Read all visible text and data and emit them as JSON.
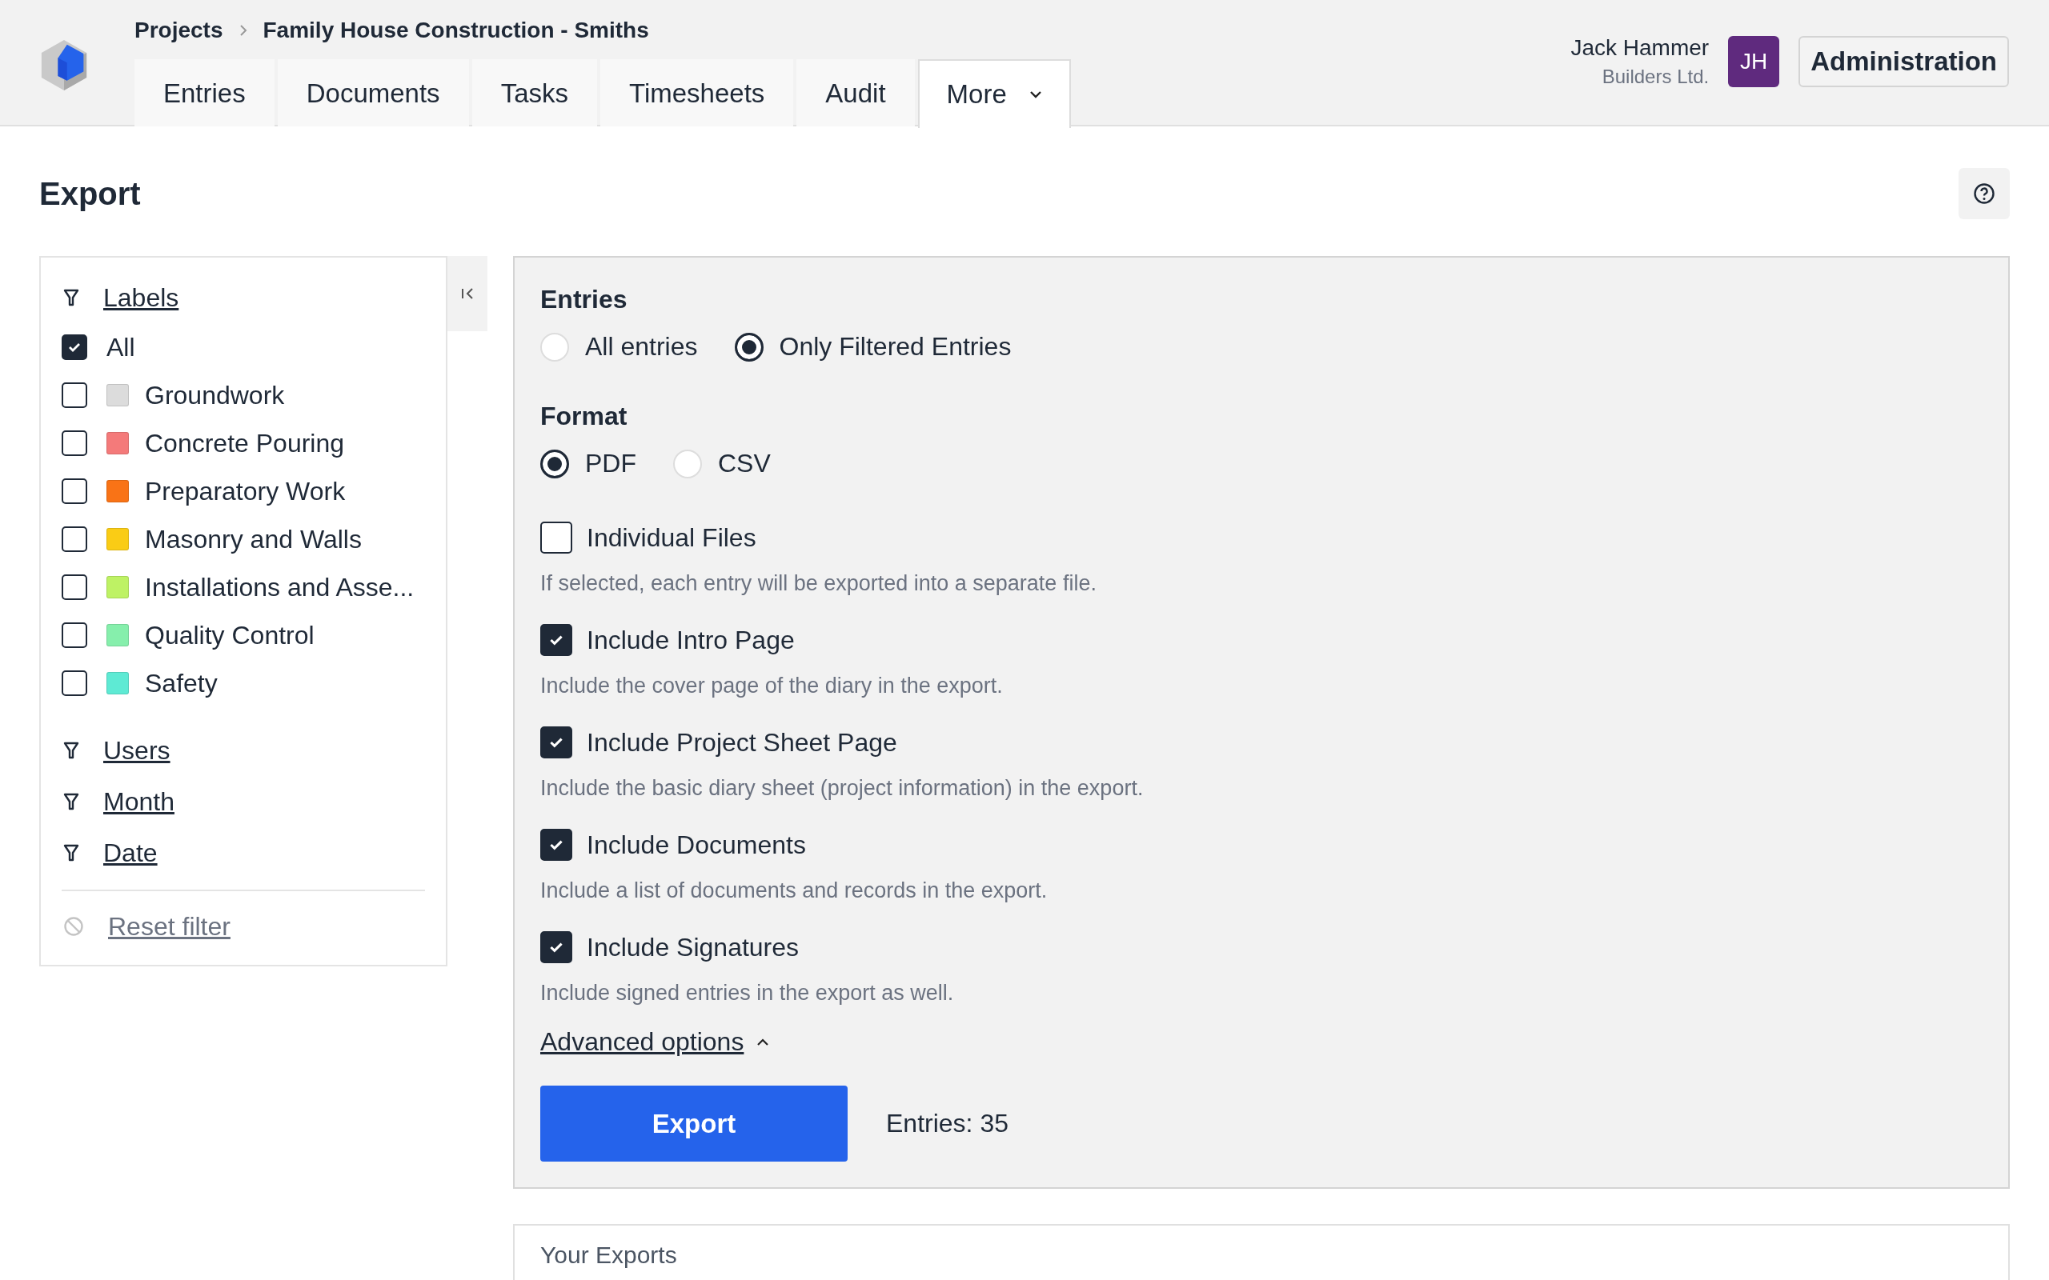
{
  "breadcrumb": [
    {
      "label": "Projects"
    },
    {
      "label": "Family House Construction - Smiths"
    }
  ],
  "tabs": [
    {
      "label": "Entries",
      "selected": false,
      "dropdown": false
    },
    {
      "label": "Documents",
      "selected": false,
      "dropdown": false
    },
    {
      "label": "Tasks",
      "selected": false,
      "dropdown": false
    },
    {
      "label": "Timesheets",
      "selected": false,
      "dropdown": false
    },
    {
      "label": "Audit",
      "selected": false,
      "dropdown": false
    },
    {
      "label": "More",
      "selected": true,
      "dropdown": true
    }
  ],
  "user": {
    "name": "Jack Hammer",
    "company": "Builders Ltd.",
    "initials": "JH"
  },
  "admin_button": "Administration",
  "page_title": "Export",
  "filters": {
    "labels_heading": "Labels",
    "labels": [
      {
        "label": "All",
        "checked": true
      },
      {
        "label": "Groundwork",
        "checked": false,
        "color": "#dcdcdc"
      },
      {
        "label": "Concrete Pouring",
        "checked": false,
        "color": "#f47a7a"
      },
      {
        "label": "Preparatory Work",
        "checked": false,
        "color": "#f97316"
      },
      {
        "label": "Masonry and Walls",
        "checked": false,
        "color": "#facc15"
      },
      {
        "label": "Installations and Asse...",
        "checked": false,
        "color": "#bef264"
      },
      {
        "label": "Quality Control",
        "checked": false,
        "color": "#86efac"
      },
      {
        "label": "Safety",
        "checked": false,
        "color": "#5eead4"
      }
    ],
    "other_filters": [
      "Users",
      "Month",
      "Date"
    ],
    "reset": "Reset filter"
  },
  "entries_group": {
    "title": "Entries",
    "options": [
      {
        "label": "All entries",
        "selected": false
      },
      {
        "label": "Only Filtered Entries",
        "selected": true
      }
    ]
  },
  "format_group": {
    "title": "Format",
    "options": [
      {
        "label": "PDF",
        "selected": true
      },
      {
        "label": "CSV",
        "selected": false
      }
    ]
  },
  "options": [
    {
      "label": "Individual Files",
      "checked": false,
      "description": "If selected, each entry will be exported into a separate file."
    },
    {
      "label": "Include Intro Page",
      "checked": true,
      "description": "Include the cover page of the diary in the export."
    },
    {
      "label": "Include Project Sheet Page",
      "checked": true,
      "description": "Include the basic diary sheet (project information) in the export."
    },
    {
      "label": "Include Documents",
      "checked": true,
      "description": "Include a list of documents and records in the export."
    },
    {
      "label": "Include Signatures",
      "checked": true,
      "description": "Include signed entries in the export as well."
    }
  ],
  "advanced_options": {
    "label": "Advanced options",
    "expanded": true
  },
  "export_button": "Export",
  "entries_count": "Entries: 35",
  "your_exports": {
    "title": "Your Exports"
  }
}
